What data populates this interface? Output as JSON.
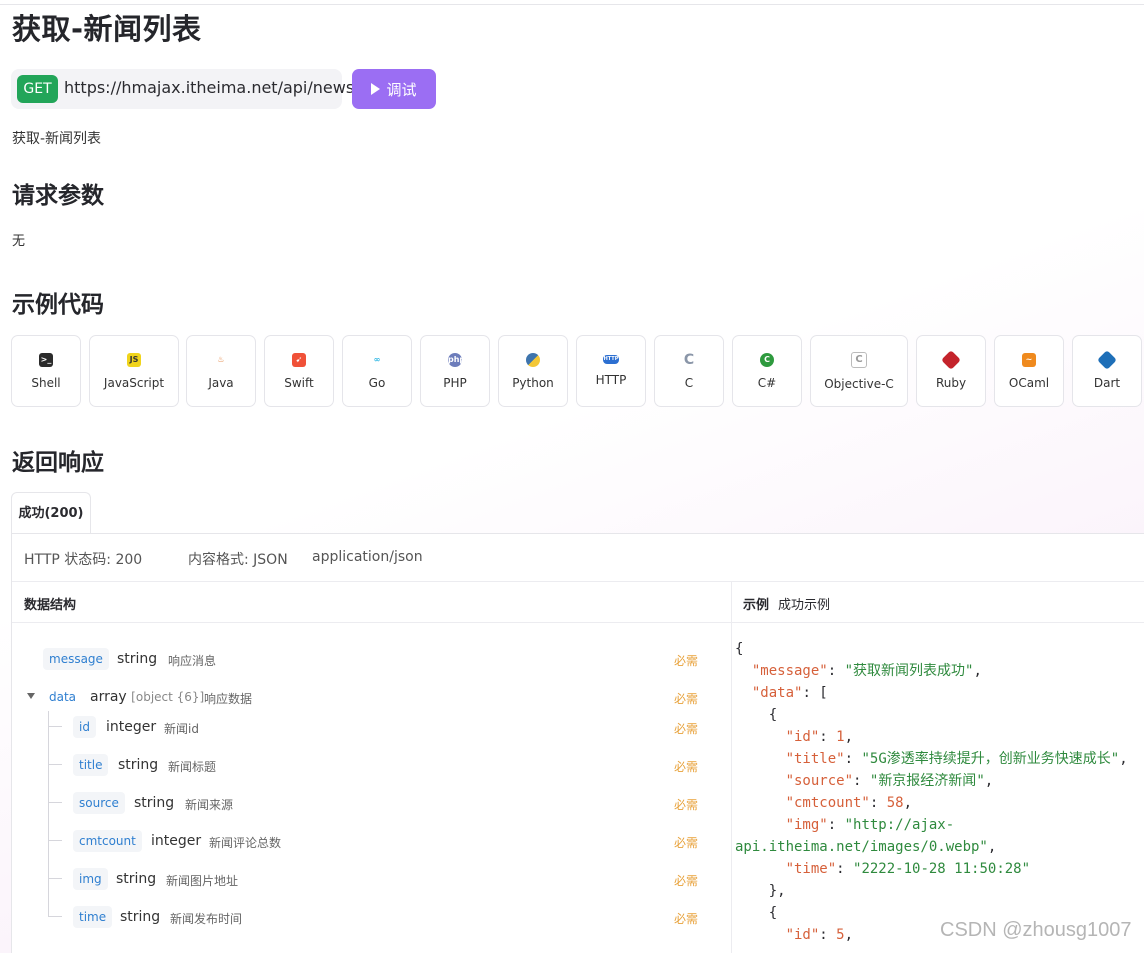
{
  "page": {
    "title": "获取-新闻列表",
    "method": "GET",
    "url": "https://hmajax.itheima.net/api/news",
    "debug_label": "调试",
    "description": "获取-新闻列表"
  },
  "sections": {
    "request_params": "请求参数",
    "request_params_value": "无",
    "sample_code": "示例代码",
    "response": "返回响应"
  },
  "languages": [
    {
      "label": "Shell",
      "icon": "terminal-icon",
      "color": "#2b2b2b"
    },
    {
      "label": "JavaScript",
      "icon": "javascript-icon",
      "color": "#f0d41c"
    },
    {
      "label": "Java",
      "icon": "java-icon",
      "color": "#e0782f"
    },
    {
      "label": "Swift",
      "icon": "swift-icon",
      "color": "#f05138"
    },
    {
      "label": "Go",
      "icon": "go-icon",
      "color": "#29b5e3"
    },
    {
      "label": "PHP",
      "icon": "php-icon",
      "color": "#6d7dbb"
    },
    {
      "label": "Python",
      "icon": "python-icon",
      "color": "#3e74ad"
    },
    {
      "label": "HTTP",
      "icon": "http-icon",
      "color": "#2c6fd1"
    },
    {
      "label": "C",
      "icon": "c-icon",
      "color": "#8a96a8"
    },
    {
      "label": "C#",
      "icon": "csharp-icon",
      "color": "#2e9a3e"
    },
    {
      "label": "Objective-C",
      "icon": "objective-c-icon",
      "color": "#9a9a9a"
    },
    {
      "label": "Ruby",
      "icon": "ruby-icon",
      "color": "#c4232b"
    },
    {
      "label": "OCaml",
      "icon": "ocaml-icon",
      "color": "#ef8a1e"
    },
    {
      "label": "Dart",
      "icon": "dart-icon",
      "color": "#1e6fb8"
    }
  ],
  "response": {
    "tab_label": "成功(200)",
    "status_code": "HTTP 状态码: 200",
    "content_format": "内容格式: JSON",
    "content_type": "application/json",
    "struct_header": "数据结构",
    "example_header": "示例",
    "example_name": "成功示例",
    "required_label": "必需",
    "fields": [
      {
        "name": "message",
        "type": "string",
        "desc": "响应消息"
      },
      {
        "name": "data",
        "type": "array",
        "type_sub": "[object {6}]",
        "desc": "响应数据"
      },
      {
        "name": "id",
        "type": "integer",
        "desc": "新闻id"
      },
      {
        "name": "title",
        "type": "string",
        "desc": "新闻标题"
      },
      {
        "name": "source",
        "type": "string",
        "desc": "新闻来源"
      },
      {
        "name": "cmtcount",
        "type": "integer",
        "desc": "新闻评论总数"
      },
      {
        "name": "img",
        "type": "string",
        "desc": "新闻图片地址"
      },
      {
        "name": "time",
        "type": "string",
        "desc": "新闻发布时间"
      }
    ],
    "example": {
      "message": "获取新闻列表成功",
      "item1": {
        "id": "1",
        "title": "5G渗透率持续提升，创新业务快速成长",
        "source": "新京报经济新闻",
        "cmtcount": "58",
        "img_line1": "\"http://ajax-",
        "img_line2": "api.itheima.net/images/0.webp\"",
        "time": "2222-10-28 11:50:28"
      },
      "item2_id": "5"
    }
  },
  "watermark": "CSDN @zhousg1007"
}
